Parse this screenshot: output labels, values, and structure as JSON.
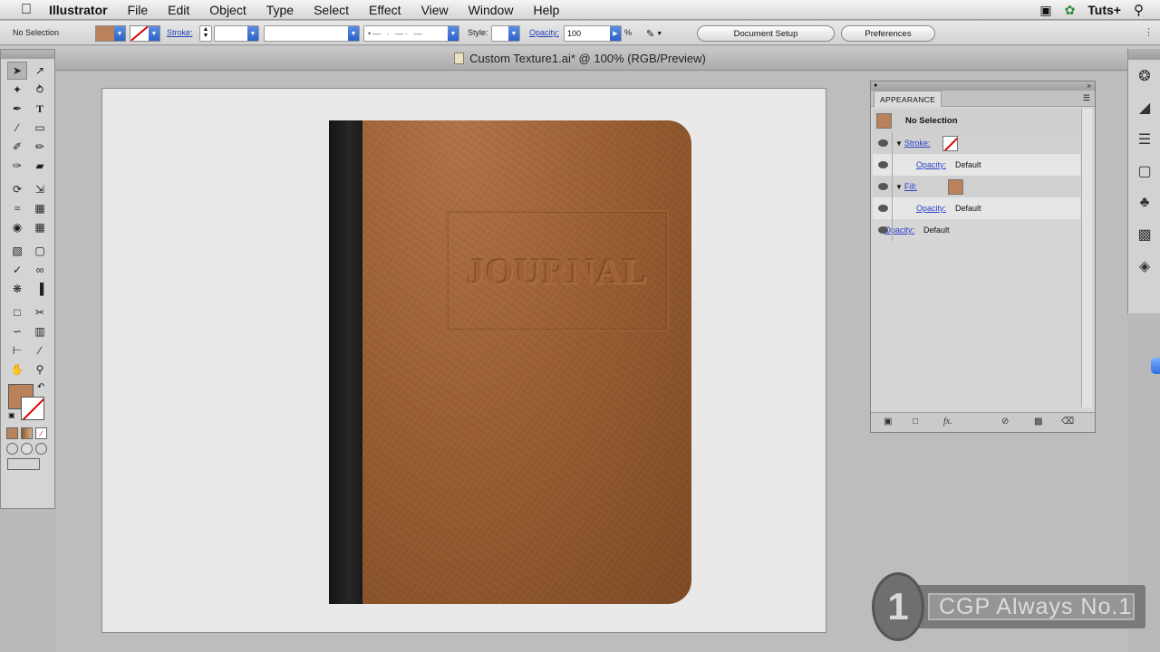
{
  "menubar": {
    "app_name": "Illustrator",
    "items": [
      "File",
      "Edit",
      "Object",
      "Type",
      "Select",
      "Effect",
      "View",
      "Window",
      "Help"
    ],
    "right_label": "Tuts+"
  },
  "control_bar": {
    "selection_label": "No Selection",
    "stroke_label": "Stroke:",
    "style_label": "Style:",
    "opacity_label": "Opacity:",
    "opacity_value": "100",
    "opacity_unit": "%",
    "document_setup_button": "Document Setup",
    "preferences_button": "Preferences"
  },
  "document_tab": {
    "title": "Custom Texture1.ai* @ 100% (RGB/Preview)"
  },
  "artwork": {
    "cover_title": "JOURNAL",
    "cover_color": "#9a5f32",
    "spine_color": "#1a1a1a"
  },
  "appearance_panel": {
    "tab_label": "APPEARANCE",
    "header_label": "No Selection",
    "rows": [
      {
        "label": "Stroke:",
        "value": ""
      },
      {
        "label": "Opacity:",
        "value": "Default"
      },
      {
        "label": "Fill:",
        "value": ""
      },
      {
        "label": "Opacity:",
        "value": "Default"
      },
      {
        "label": "Opacity:",
        "value": "Default"
      }
    ],
    "fill_color": "#b9825a"
  },
  "watermark": {
    "number": "1",
    "text": "CGP Always No.1"
  }
}
